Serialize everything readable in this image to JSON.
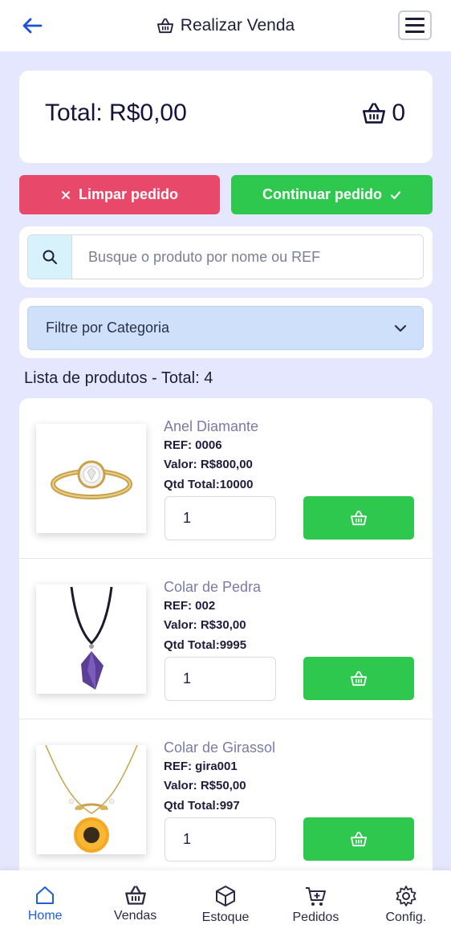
{
  "header": {
    "title": "Realizar Venda",
    "back_icon": "arrow-left-icon",
    "menu_icon": "hamburger-icon"
  },
  "summary": {
    "total_label": "Total: R$0,00",
    "cart_count": "0"
  },
  "actions": {
    "clear_label": "Limpar pedido",
    "continue_label": "Continuar pedido"
  },
  "search": {
    "placeholder": "Busque o produto por nome ou REF",
    "value": ""
  },
  "filter": {
    "selected": "Filtre por Categoria"
  },
  "products_heading": "Lista de produtos - Total: 4",
  "products": [
    {
      "name": "Anel Diamante",
      "ref": "REF: 0006",
      "price": "Valor: R$800,00",
      "qty_total": "Qtd Total:10000",
      "qty_value": "1",
      "image": "ring-image"
    },
    {
      "name": "Colar de Pedra",
      "ref": "REF: 002",
      "price": "Valor: R$30,00",
      "qty_total": "Qtd Total:9995",
      "qty_value": "1",
      "image": "stone-necklace-image"
    },
    {
      "name": "Colar de Girassol",
      "ref": "REF: gira001",
      "price": "Valor: R$50,00",
      "qty_total": "Qtd Total:997",
      "qty_value": "1",
      "image": "sunflower-necklace-image"
    }
  ],
  "nav": {
    "items": [
      {
        "label": "Home",
        "icon": "home-icon",
        "active": true
      },
      {
        "label": "Vendas",
        "icon": "basket-icon",
        "active": false
      },
      {
        "label": "Estoque",
        "icon": "box-icon",
        "active": false
      },
      {
        "label": "Pedidos",
        "icon": "cart-plus-icon",
        "active": false
      },
      {
        "label": "Config.",
        "icon": "gear-icon",
        "active": false
      }
    ]
  },
  "colors": {
    "background": "#e4e7fd",
    "danger": "#e8496a",
    "success": "#2ec84f",
    "primary": "#1d5fdc",
    "filter_bg": "#cfe0fb"
  }
}
